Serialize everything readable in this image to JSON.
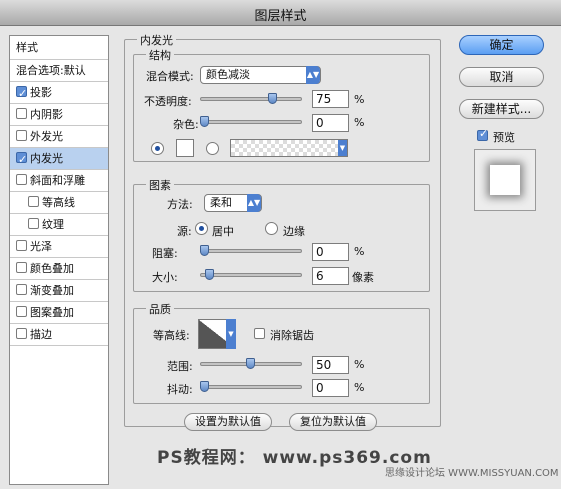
{
  "title": "图层样式",
  "sidebar": {
    "header": "样式",
    "items": [
      {
        "label": "混合选项:默认",
        "checkbox": null,
        "checked": false,
        "selected": false
      },
      {
        "label": "投影",
        "checkbox": true,
        "checked": true,
        "selected": false
      },
      {
        "label": "内阴影",
        "checkbox": true,
        "checked": false,
        "selected": false
      },
      {
        "label": "外发光",
        "checkbox": true,
        "checked": false,
        "selected": false
      },
      {
        "label": "内发光",
        "checkbox": true,
        "checked": true,
        "selected": true
      },
      {
        "label": "斜面和浮雕",
        "checkbox": true,
        "checked": false,
        "selected": false
      },
      {
        "label": "等高线",
        "checkbox": true,
        "checked": false,
        "selected": false
      },
      {
        "label": "纹理",
        "checkbox": true,
        "checked": false,
        "selected": false
      },
      {
        "label": "光泽",
        "checkbox": true,
        "checked": false,
        "selected": false
      },
      {
        "label": "颜色叠加",
        "checkbox": true,
        "checked": false,
        "selected": false
      },
      {
        "label": "渐变叠加",
        "checkbox": true,
        "checked": false,
        "selected": false
      },
      {
        "label": "图案叠加",
        "checkbox": true,
        "checked": false,
        "selected": false
      },
      {
        "label": "描边",
        "checkbox": true,
        "checked": false,
        "selected": false
      }
    ]
  },
  "panel": {
    "title": "内发光",
    "structure": {
      "legend": "结构",
      "blend_mode_label": "混合模式:",
      "blend_mode_value": "颜色减淡",
      "opacity_label": "不透明度:",
      "opacity_value": "75",
      "opacity_unit": "%",
      "opacity_fraction": 0.75,
      "noise_label": "杂色:",
      "noise_value": "0",
      "noise_unit": "%",
      "noise_fraction": 0.0,
      "color_radio_selected": true,
      "gradient_radio_selected": false
    },
    "elements": {
      "legend": "图素",
      "method_label": "方法:",
      "method_value": "柔和",
      "source_label": "源:",
      "source_center": "居中",
      "source_edge": "边缘",
      "source_selected": "center",
      "choke_label": "阻塞:",
      "choke_value": "0",
      "choke_unit": "%",
      "choke_fraction": 0.0,
      "size_label": "大小:",
      "size_value": "6",
      "size_unit": "像素",
      "size_fraction": 0.06
    },
    "quality": {
      "legend": "品质",
      "contour_label": "等高线:",
      "antialias_label": "消除锯齿",
      "antialias_checked": false,
      "range_label": "范围:",
      "range_value": "50",
      "range_unit": "%",
      "range_fraction": 0.5,
      "jitter_label": "抖动:",
      "jitter_value": "0",
      "jitter_unit": "%",
      "jitter_fraction": 0.0
    },
    "buttons": {
      "set_default": "设置为默认值",
      "reset_default": "复位为默认值"
    }
  },
  "right": {
    "ok": "确定",
    "cancel": "取消",
    "new_style": "新建样式...",
    "preview_label": "预览",
    "preview_checked": true
  },
  "watermark": "PS教程网： www.ps369.com",
  "credit": "思缘设计论坛 WWW.MISSYUAN.COM",
  "colors": {
    "accent": "#4c7fd0",
    "selection": "#b9d1ef"
  }
}
